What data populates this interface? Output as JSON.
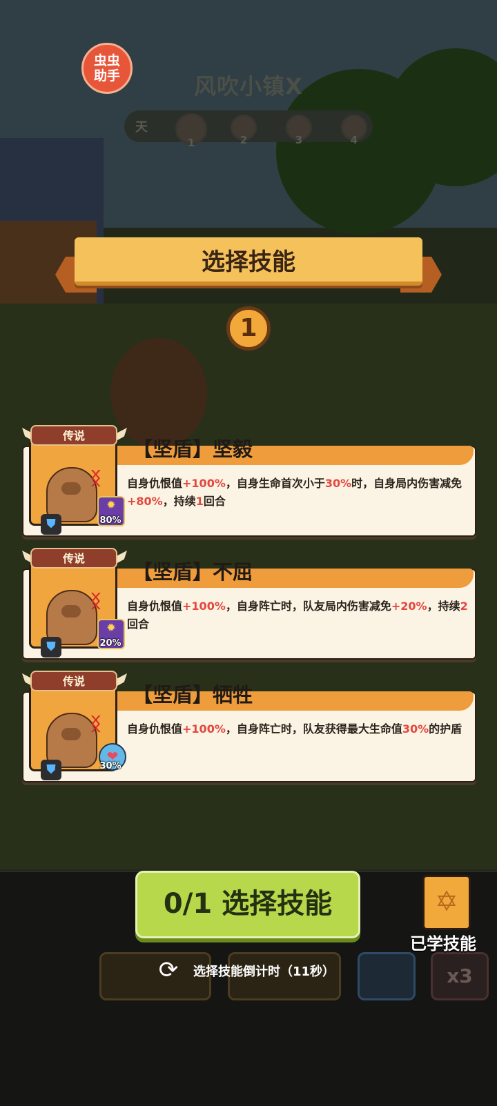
{
  "helper_badge": {
    "line1": "虫虫",
    "line2": "助手"
  },
  "stage": {
    "title": "风吹小镇X",
    "day_label": "天",
    "nodes": [
      "1",
      "2",
      "3",
      "4"
    ]
  },
  "panel": {
    "title": "选择技能",
    "remaining_choices": "1"
  },
  "skills": [
    {
      "rarity": "传说",
      "title": "【坚盾】坚毅",
      "desc": [
        {
          "t": "自身仇恨值"
        },
        {
          "t": "+100%",
          "hl": true
        },
        {
          "t": "，自身生命首次小于"
        },
        {
          "t": "30%",
          "hl": true
        },
        {
          "t": "时，自身局内伤害减免"
        },
        {
          "t": "+80%",
          "hl": true
        },
        {
          "t": "，持续"
        },
        {
          "t": "1",
          "hl": true
        },
        {
          "t": "回合"
        }
      ],
      "badge": "80%",
      "badge_icon": "sun-buff-icon"
    },
    {
      "rarity": "传说",
      "title": "【坚盾】不屈",
      "desc": [
        {
          "t": "自身仇恨值"
        },
        {
          "t": "+100%",
          "hl": true
        },
        {
          "t": "，自身阵亡时，队友局内伤害减免"
        },
        {
          "t": "+20%",
          "hl": true
        },
        {
          "t": "，持续"
        },
        {
          "t": "2",
          "hl": true
        },
        {
          "t": "回合"
        }
      ],
      "badge": "20%",
      "badge_icon": "sun-buff-icon"
    },
    {
      "rarity": "传说",
      "title": "【坚盾】牺牲",
      "desc": [
        {
          "t": "自身仇恨值"
        },
        {
          "t": "+100%",
          "hl": true
        },
        {
          "t": "，自身阵亡时，队友获得最大生命值"
        },
        {
          "t": "30%",
          "hl": true
        },
        {
          "t": "的护盾"
        }
      ],
      "badge": "30%",
      "badge_icon": "heart-shield-icon"
    }
  ],
  "footer": {
    "select_button": "0/1 选择技能",
    "learned_label": "已学技能",
    "countdown": "选择技能倒计时（11秒）",
    "speed_label": "x3"
  },
  "colors": {
    "highlight": "#e3473f",
    "button": "#b6d84a",
    "ribbon": "#f4c15a"
  }
}
